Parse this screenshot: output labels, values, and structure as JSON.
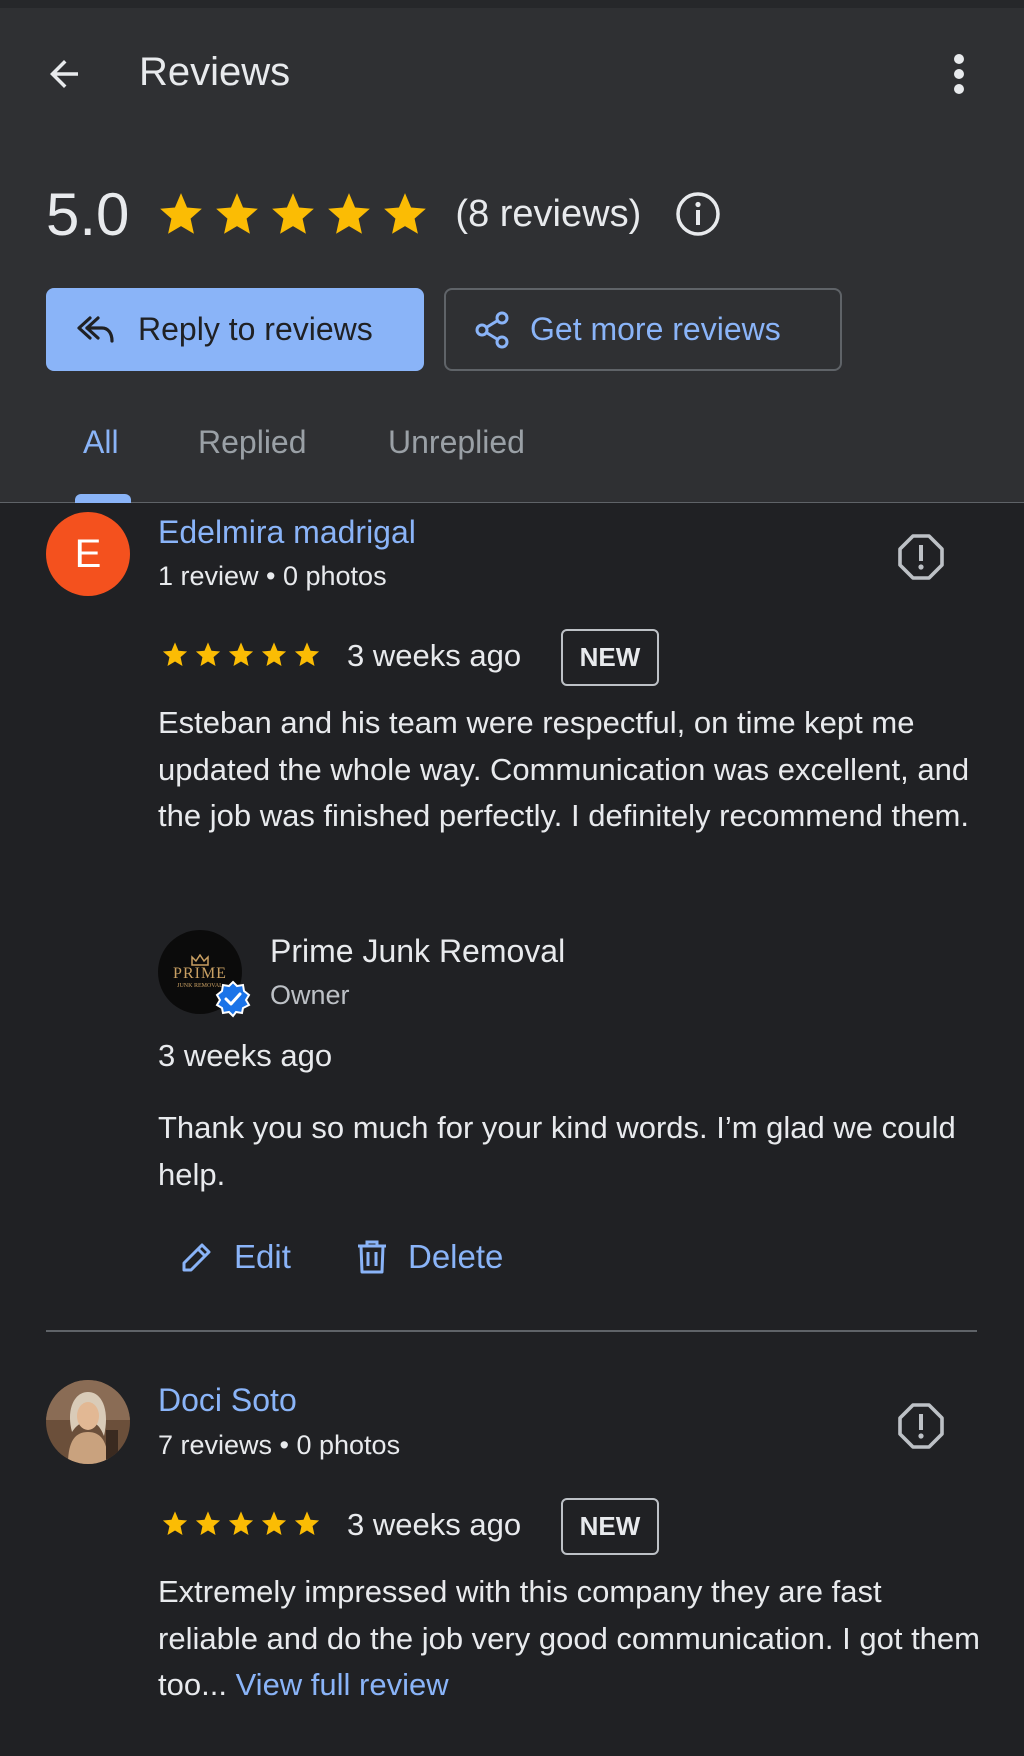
{
  "header": {
    "title": "Reviews",
    "rating": "5.0",
    "rating_stars": 5,
    "review_count": "(8 reviews)",
    "reply_button": "Reply to reviews",
    "more_button": "Get more reviews"
  },
  "tabs": [
    {
      "label": "All",
      "active": true
    },
    {
      "label": "Replied",
      "active": false
    },
    {
      "label": "Unreplied",
      "active": false
    }
  ],
  "reviews": [
    {
      "avatar_letter": "E",
      "name": "Edelmira madrigal",
      "meta": "1 review • 0 photos",
      "stars": 5,
      "time": "3 weeks ago",
      "badge": "NEW",
      "text": "Esteban and his team were respectful, on time kept me updated the whole way. Communication was excellent, and the job was finished perfectly. I definitely recommend them.",
      "reply": {
        "logo_text": "PRIME",
        "logo_subtext": "JUNK REMOVAL",
        "owner_name": "Prime Junk Removal",
        "owner_role": "Owner",
        "time": "3 weeks ago",
        "text": "Thank you so much for your kind words. I’m glad we could help.",
        "edit_label": "Edit",
        "delete_label": "Delete"
      }
    },
    {
      "name": "Doci Soto",
      "meta": "7 reviews • 0 photos",
      "stars": 5,
      "time": "3 weeks ago",
      "badge": "NEW",
      "text": "Extremely impressed with this company they are fast reliable and do the job very good communication. I got them too...",
      "view_full_label": "View full review"
    }
  ],
  "colors": {
    "accent": "#8ab4f8",
    "star": "#fbbc04",
    "header_bg": "#2f3033",
    "page_bg": "#202124",
    "avatar_e": "#f4511e",
    "verified": "#1a73e8"
  },
  "icons": {
    "back": "arrow-left-icon",
    "more": "more-vert-icon",
    "info": "info-icon",
    "reply_all": "reply-all-icon",
    "share": "share-icon",
    "flag": "report-icon",
    "edit": "pencil-icon",
    "delete": "trash-icon",
    "verified": "verified-badge-icon"
  }
}
